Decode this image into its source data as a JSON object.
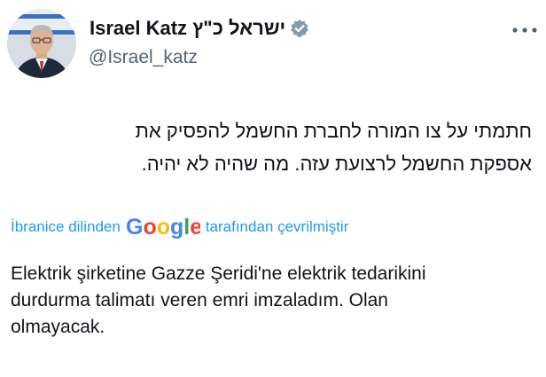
{
  "author": {
    "name": "Israel Katz ישראל כ\"ץ",
    "handle": "@Israel_katz",
    "verified": true,
    "verified_color": "#829aab"
  },
  "post": {
    "original_lines": [
      "חתמתי על צו המורה לחברת החשמל להפסיק את",
      "אספקת החשמל לרצועת עזה. מה שהיה לא יהיה."
    ],
    "translation_prefix": "İbranice dilinden",
    "translation_provider": "Google",
    "translation_suffix": "tarafından çevrilmiştir",
    "translated_lines": [
      "Elektrik şirketine Gazze Şeridi'ne elektrik tedarikini",
      "durdurma talimatı veren emri imzaladım. Olan",
      "olmayacak."
    ]
  },
  "icons": {
    "more": "more-options-icon",
    "verified": "verified-badge-icon"
  },
  "colors": {
    "link": "#1d9bf0",
    "secondary_text": "#536471",
    "primary_text": "#0f1419"
  }
}
